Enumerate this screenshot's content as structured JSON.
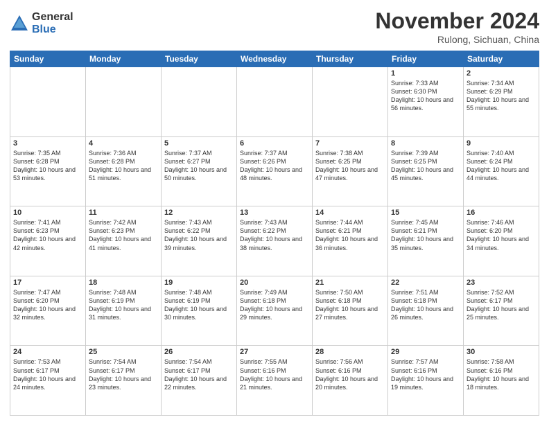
{
  "logo": {
    "general": "General",
    "blue": "Blue"
  },
  "header": {
    "month": "November 2024",
    "location": "Rulong, Sichuan, China"
  },
  "weekdays": [
    "Sunday",
    "Monday",
    "Tuesday",
    "Wednesday",
    "Thursday",
    "Friday",
    "Saturday"
  ],
  "weeks": [
    [
      {
        "day": "",
        "info": ""
      },
      {
        "day": "",
        "info": ""
      },
      {
        "day": "",
        "info": ""
      },
      {
        "day": "",
        "info": ""
      },
      {
        "day": "",
        "info": ""
      },
      {
        "day": "1",
        "info": "Sunrise: 7:33 AM\nSunset: 6:30 PM\nDaylight: 10 hours and 56 minutes."
      },
      {
        "day": "2",
        "info": "Sunrise: 7:34 AM\nSunset: 6:29 PM\nDaylight: 10 hours and 55 minutes."
      }
    ],
    [
      {
        "day": "3",
        "info": "Sunrise: 7:35 AM\nSunset: 6:28 PM\nDaylight: 10 hours and 53 minutes."
      },
      {
        "day": "4",
        "info": "Sunrise: 7:36 AM\nSunset: 6:28 PM\nDaylight: 10 hours and 51 minutes."
      },
      {
        "day": "5",
        "info": "Sunrise: 7:37 AM\nSunset: 6:27 PM\nDaylight: 10 hours and 50 minutes."
      },
      {
        "day": "6",
        "info": "Sunrise: 7:37 AM\nSunset: 6:26 PM\nDaylight: 10 hours and 48 minutes."
      },
      {
        "day": "7",
        "info": "Sunrise: 7:38 AM\nSunset: 6:25 PM\nDaylight: 10 hours and 47 minutes."
      },
      {
        "day": "8",
        "info": "Sunrise: 7:39 AM\nSunset: 6:25 PM\nDaylight: 10 hours and 45 minutes."
      },
      {
        "day": "9",
        "info": "Sunrise: 7:40 AM\nSunset: 6:24 PM\nDaylight: 10 hours and 44 minutes."
      }
    ],
    [
      {
        "day": "10",
        "info": "Sunrise: 7:41 AM\nSunset: 6:23 PM\nDaylight: 10 hours and 42 minutes."
      },
      {
        "day": "11",
        "info": "Sunrise: 7:42 AM\nSunset: 6:23 PM\nDaylight: 10 hours and 41 minutes."
      },
      {
        "day": "12",
        "info": "Sunrise: 7:43 AM\nSunset: 6:22 PM\nDaylight: 10 hours and 39 minutes."
      },
      {
        "day": "13",
        "info": "Sunrise: 7:43 AM\nSunset: 6:22 PM\nDaylight: 10 hours and 38 minutes."
      },
      {
        "day": "14",
        "info": "Sunrise: 7:44 AM\nSunset: 6:21 PM\nDaylight: 10 hours and 36 minutes."
      },
      {
        "day": "15",
        "info": "Sunrise: 7:45 AM\nSunset: 6:21 PM\nDaylight: 10 hours and 35 minutes."
      },
      {
        "day": "16",
        "info": "Sunrise: 7:46 AM\nSunset: 6:20 PM\nDaylight: 10 hours and 34 minutes."
      }
    ],
    [
      {
        "day": "17",
        "info": "Sunrise: 7:47 AM\nSunset: 6:20 PM\nDaylight: 10 hours and 32 minutes."
      },
      {
        "day": "18",
        "info": "Sunrise: 7:48 AM\nSunset: 6:19 PM\nDaylight: 10 hours and 31 minutes."
      },
      {
        "day": "19",
        "info": "Sunrise: 7:48 AM\nSunset: 6:19 PM\nDaylight: 10 hours and 30 minutes."
      },
      {
        "day": "20",
        "info": "Sunrise: 7:49 AM\nSunset: 6:18 PM\nDaylight: 10 hours and 29 minutes."
      },
      {
        "day": "21",
        "info": "Sunrise: 7:50 AM\nSunset: 6:18 PM\nDaylight: 10 hours and 27 minutes."
      },
      {
        "day": "22",
        "info": "Sunrise: 7:51 AM\nSunset: 6:18 PM\nDaylight: 10 hours and 26 minutes."
      },
      {
        "day": "23",
        "info": "Sunrise: 7:52 AM\nSunset: 6:17 PM\nDaylight: 10 hours and 25 minutes."
      }
    ],
    [
      {
        "day": "24",
        "info": "Sunrise: 7:53 AM\nSunset: 6:17 PM\nDaylight: 10 hours and 24 minutes."
      },
      {
        "day": "25",
        "info": "Sunrise: 7:54 AM\nSunset: 6:17 PM\nDaylight: 10 hours and 23 minutes."
      },
      {
        "day": "26",
        "info": "Sunrise: 7:54 AM\nSunset: 6:17 PM\nDaylight: 10 hours and 22 minutes."
      },
      {
        "day": "27",
        "info": "Sunrise: 7:55 AM\nSunset: 6:16 PM\nDaylight: 10 hours and 21 minutes."
      },
      {
        "day": "28",
        "info": "Sunrise: 7:56 AM\nSunset: 6:16 PM\nDaylight: 10 hours and 20 minutes."
      },
      {
        "day": "29",
        "info": "Sunrise: 7:57 AM\nSunset: 6:16 PM\nDaylight: 10 hours and 19 minutes."
      },
      {
        "day": "30",
        "info": "Sunrise: 7:58 AM\nSunset: 6:16 PM\nDaylight: 10 hours and 18 minutes."
      }
    ]
  ]
}
